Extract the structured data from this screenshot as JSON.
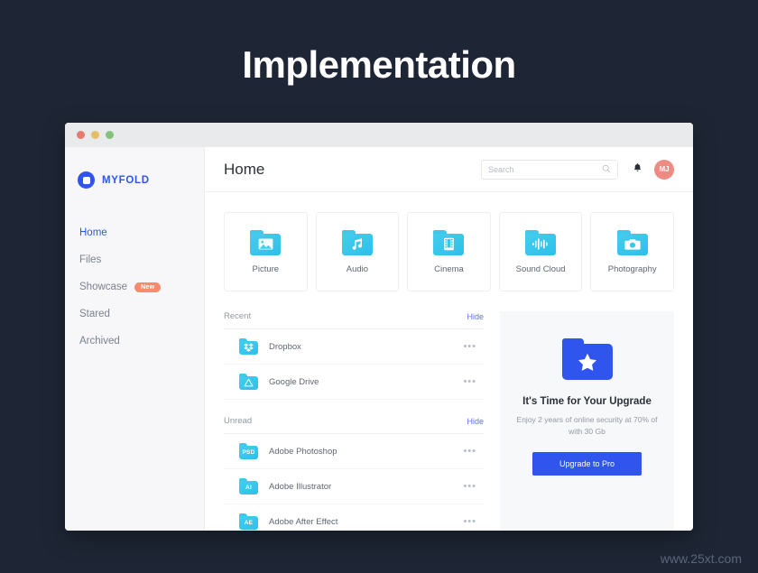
{
  "heading": "Implementation",
  "watermark": "www.25xt.com",
  "window": {
    "traffic_lights": [
      "close",
      "minimize",
      "maximize"
    ]
  },
  "sidebar": {
    "brand": {
      "name": "MYFOLD",
      "icon": "folder-logo-icon",
      "color": "#2f55ee"
    },
    "items": [
      {
        "label": "Home",
        "active": true
      },
      {
        "label": "Files",
        "active": false
      },
      {
        "label": "Showcase",
        "active": false,
        "badge": "New"
      },
      {
        "label": "Stared",
        "active": false
      },
      {
        "label": "Archived",
        "active": false
      }
    ]
  },
  "topbar": {
    "title": "Home",
    "search": {
      "value": "",
      "placeholder": "Search",
      "icon": "search-icon"
    },
    "bell_icon": "bell-icon",
    "avatar": {
      "initials": "MJ",
      "color": "#f08b84"
    }
  },
  "cards": [
    {
      "label": "Picture",
      "icon": "image-folder-icon"
    },
    {
      "label": "Audio",
      "icon": "music-folder-icon"
    },
    {
      "label": "Cinema",
      "icon": "film-folder-icon"
    },
    {
      "label": "Sound Cloud",
      "icon": "waveform-folder-icon"
    },
    {
      "label": "Photography",
      "icon": "camera-folder-icon"
    }
  ],
  "sections": [
    {
      "title": "Recent",
      "hide_label": "Hide",
      "rows": [
        {
          "name": "Dropbox",
          "icon": "dropbox-folder-icon",
          "more": "•••"
        },
        {
          "name": "Google Drive",
          "icon": "google-drive-folder-icon",
          "more": "•••"
        }
      ]
    },
    {
      "title": "Unread",
      "hide_label": "Hide",
      "rows": [
        {
          "name": "Adobe Photoshop",
          "icon": "psd-folder-icon",
          "tag": "PSD",
          "more": "•••"
        },
        {
          "name": "Adobe Illustrator",
          "icon": "ai-folder-icon",
          "tag": "AI",
          "more": "•••"
        },
        {
          "name": "Adobe After Effect",
          "icon": "ae-folder-icon",
          "tag": "AE",
          "more": "•••"
        }
      ]
    }
  ],
  "promo": {
    "icon": "star-folder-icon",
    "title": "It's Time for Your Upgrade",
    "subtitle": "Enjoy 2 years of online security at 70% of with 30 Gb",
    "button": "Upgrade to Pro",
    "accent": "#2f55ee"
  }
}
